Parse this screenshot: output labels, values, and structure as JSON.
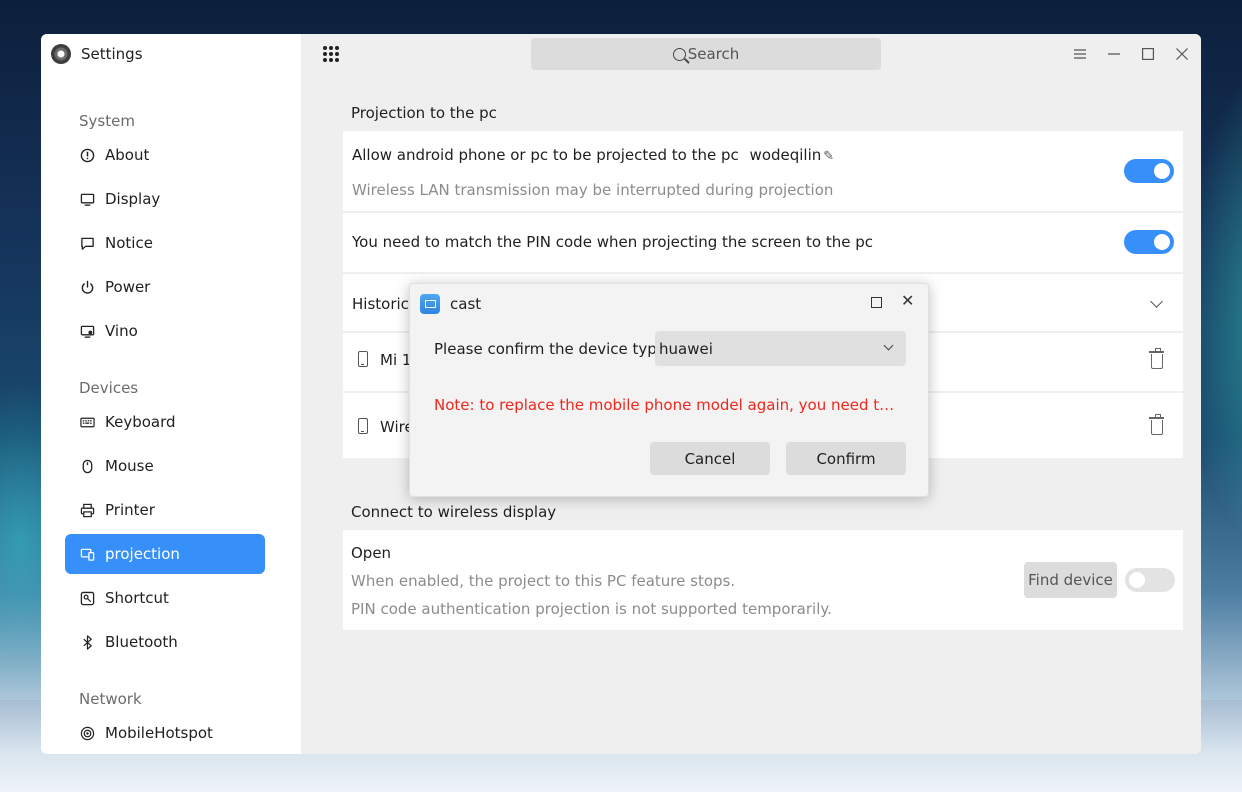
{
  "app": {
    "title": "Settings"
  },
  "search": {
    "label": "Search"
  },
  "sidebar": {
    "groups": [
      {
        "label": "System"
      },
      {
        "label": "Devices"
      },
      {
        "label": "Network"
      }
    ],
    "items": [
      {
        "label": "About",
        "icon": "info-icon"
      },
      {
        "label": "Display",
        "icon": "monitor-icon"
      },
      {
        "label": "Notice",
        "icon": "message-icon"
      },
      {
        "label": "Power",
        "icon": "power-icon"
      },
      {
        "label": "Vino",
        "icon": "remote-desktop-icon"
      },
      {
        "label": "Keyboard",
        "icon": "keyboard-icon"
      },
      {
        "label": "Mouse",
        "icon": "mouse-icon"
      },
      {
        "label": "Printer",
        "icon": "printer-icon"
      },
      {
        "label": "projection",
        "icon": "projection-icon",
        "active": true
      },
      {
        "label": "Shortcut",
        "icon": "shortcut-icon"
      },
      {
        "label": "Bluetooth",
        "icon": "bluetooth-icon"
      },
      {
        "label": "MobileHotspot",
        "icon": "hotspot-icon"
      }
    ]
  },
  "projection": {
    "section_title": "Projection to the pc",
    "allow_label": "Allow android phone or pc to be projected to the pc",
    "device_name": "wodeqilin",
    "allow_sub": "Wireless LAN transmission may be interrupted during projection",
    "allow_enabled": true,
    "pin_label": "You need to match the PIN code when projecting the screen to the pc",
    "pin_enabled": true,
    "history_label": "Historica",
    "history_devices": [
      {
        "name": "Mi 1"
      },
      {
        "name": "Wire"
      }
    ]
  },
  "wireless": {
    "section_title": "Connect to wireless display",
    "open_label": "Open",
    "sub1": "When enabled, the project to this PC feature stops.",
    "sub2": "PIN code authentication projection is not supported temporarily.",
    "find_button": "Find device",
    "enabled": false
  },
  "dialog": {
    "title": "cast",
    "label": "Please confirm the device type",
    "selected": "huawei",
    "note": "Note: to replace the mobile phone model again, you need t…",
    "cancel": "Cancel",
    "confirm": "Confirm"
  },
  "colors": {
    "accent": "#3790fa",
    "note_red": "#f0281e"
  }
}
